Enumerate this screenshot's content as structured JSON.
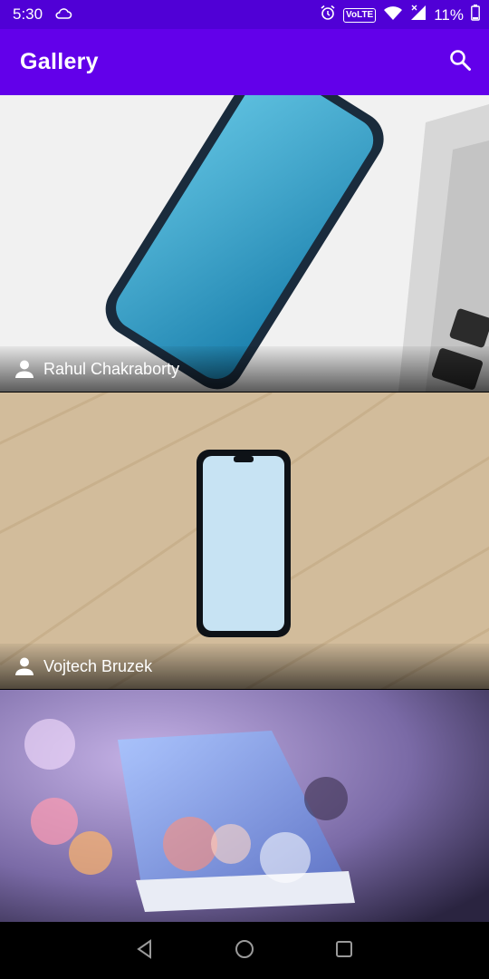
{
  "status_bar": {
    "time": "5:30",
    "network_label": "VoLTE",
    "battery": "11%",
    "icons": [
      "cloud-icon",
      "alarm-icon",
      "wifi-icon",
      "signal-icon",
      "battery-icon"
    ]
  },
  "app_bar": {
    "title": "Gallery",
    "search_icon": "search-icon"
  },
  "gallery": {
    "items": [
      {
        "author": "Rahul Chakraborty"
      },
      {
        "author": "Vojtech Bruzek"
      },
      {
        "author": ""
      }
    ]
  },
  "nav_bar": {
    "icons": [
      "back-icon",
      "home-icon",
      "recents-icon"
    ]
  },
  "colors": {
    "status_bar": "#5000d6",
    "app_bar": "#6200ea",
    "nav_bar": "#000000"
  }
}
